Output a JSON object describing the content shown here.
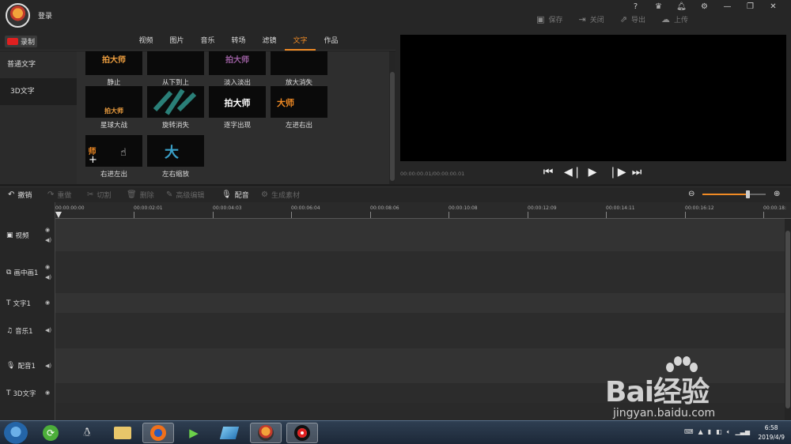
{
  "titlebar": {
    "login_label": "登录",
    "actions": [
      {
        "icon": "save-icon",
        "label": "保存"
      },
      {
        "icon": "close-doc-icon",
        "label": "关闭"
      },
      {
        "icon": "export-icon",
        "label": "导出"
      },
      {
        "icon": "upload-icon",
        "label": "上传"
      }
    ],
    "window_controls": [
      "?",
      "VIP",
      "bell",
      "gear",
      "minimize",
      "restore",
      "close"
    ]
  },
  "menubar": {
    "record_label": "录制",
    "tabs": [
      "视频",
      "图片",
      "音乐",
      "转场",
      "滤镜",
      "文字",
      "作品"
    ],
    "active_tab": "文字"
  },
  "categories": [
    {
      "label": "普通文字"
    },
    {
      "label": "3D文字"
    }
  ],
  "effects": [
    {
      "label": "静止",
      "thumb_text": "拍大师",
      "color": "#f0a040"
    },
    {
      "label": "从下到上",
      "thumb_text": "",
      "color": "#f0a040"
    },
    {
      "label": "淡入淡出",
      "thumb_text": "拍大师",
      "color": "#9b5fa0"
    },
    {
      "label": "放大消失",
      "thumb_text": "",
      "color": "#f0a040"
    },
    {
      "label": "星球大战",
      "thumb_text": "拍大师",
      "color": "#f0a040"
    },
    {
      "label": "旋转消失",
      "thumb_text": "",
      "color": "#2a8a80"
    },
    {
      "label": "逐字出现",
      "thumb_text": "拍大师",
      "color": "#ffffff"
    },
    {
      "label": "左进右出",
      "thumb_text": "大师",
      "color": "#f08a24"
    },
    {
      "label": "右进左出",
      "thumb_text": "师",
      "color": "#f08a24"
    },
    {
      "label": "左右缩放",
      "thumb_text": "大",
      "color": "#3aa0c8"
    }
  ],
  "preview": {
    "timecode": "00:00:00.01/00:00:00.01"
  },
  "edit_toolbar": [
    {
      "icon": "undo-icon",
      "label": "撤销",
      "enabled": true
    },
    {
      "icon": "redo-icon",
      "label": "重做",
      "enabled": false
    },
    {
      "icon": "cut-icon",
      "label": "切割",
      "enabled": false
    },
    {
      "icon": "delete-icon",
      "label": "删除",
      "enabled": false
    },
    {
      "icon": "edit-icon",
      "label": "高级编辑",
      "enabled": false
    },
    {
      "icon": "mic-icon",
      "label": "配音",
      "enabled": true
    },
    {
      "icon": "gear-icon",
      "label": "生成素材",
      "enabled": false
    }
  ],
  "ruler": [
    "00:00:00:00",
    "00:00:02:01",
    "00:00:04:03",
    "00:00:06:04",
    "00:00:08:06",
    "00:00:10:08",
    "00:00:12:09",
    "00:00:14:11",
    "00:00:16:12",
    "00:00:18:"
  ],
  "tracks": [
    {
      "name": "视频",
      "icon": "video-icon"
    },
    {
      "name": "画中画1",
      "icon": "pip-icon"
    },
    {
      "name": "文字1",
      "icon": "text-icon"
    },
    {
      "name": "音乐1",
      "icon": "music-icon"
    },
    {
      "name": "配音1",
      "icon": "mic-icon"
    },
    {
      "name": "3D文字",
      "icon": "text-icon"
    }
  ],
  "taskbar": {
    "clock_time": "6:58",
    "clock_date": "2019/4/9"
  },
  "watermark": {
    "brand": "Bai经验",
    "site": "jingyan.baidu.com"
  }
}
